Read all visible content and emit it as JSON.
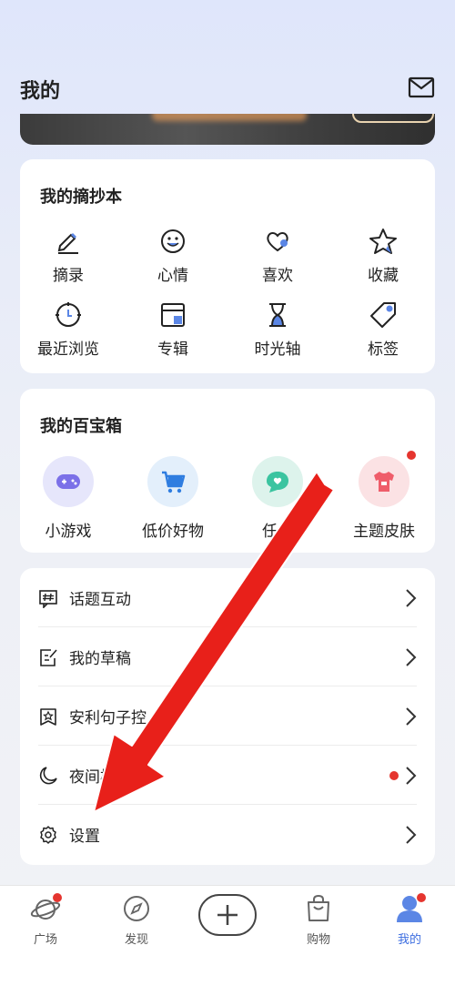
{
  "header": {
    "title": "我的"
  },
  "notebook": {
    "title": "我的摘抄本",
    "items": [
      {
        "label": "摘录",
        "icon": "pen-icon"
      },
      {
        "label": "心情",
        "icon": "smiley-icon"
      },
      {
        "label": "喜欢",
        "icon": "heart-icon"
      },
      {
        "label": "收藏",
        "icon": "star-icon"
      },
      {
        "label": "最近浏览",
        "icon": "clock-icon"
      },
      {
        "label": "专辑",
        "icon": "album-icon"
      },
      {
        "label": "时光轴",
        "icon": "hourglass-icon"
      },
      {
        "label": "标签",
        "icon": "tag-icon"
      }
    ]
  },
  "toolbox": {
    "title": "我的百宝箱",
    "items": [
      {
        "label": "小游戏",
        "icon": "gamepad-icon"
      },
      {
        "label": "低价好物",
        "icon": "cart-icon"
      },
      {
        "label": "任务",
        "icon": "chat-heart-icon"
      },
      {
        "label": "主题皮肤",
        "icon": "shirt-icon"
      }
    ]
  },
  "menu": {
    "items": [
      {
        "label": "话题互动",
        "icon": "hashtag-icon"
      },
      {
        "label": "我的草稿",
        "icon": "draft-icon"
      },
      {
        "label": "安利句子控",
        "icon": "bookmark-star-icon"
      },
      {
        "label": "夜间模式",
        "icon": "moon-icon"
      },
      {
        "label": "设置",
        "icon": "gear-icon"
      }
    ]
  },
  "tabbar": {
    "items": [
      {
        "label": "广场",
        "icon": "planet-icon"
      },
      {
        "label": "发现",
        "icon": "compass-icon"
      },
      {
        "label": "",
        "icon": "plus-icon"
      },
      {
        "label": "购物",
        "icon": "shopping-bag-icon"
      },
      {
        "label": "我的",
        "icon": "person-icon"
      }
    ]
  },
  "colors": {
    "accent": "#3c6de0",
    "badge": "#e5352f",
    "arrow": "#e8201a"
  }
}
